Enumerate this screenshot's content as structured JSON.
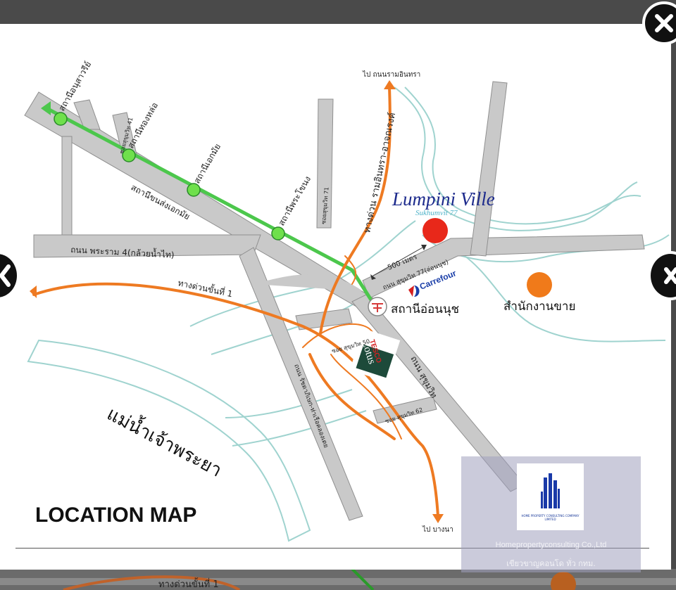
{
  "map": {
    "title": "LOCATION MAP",
    "project_name": "Lumpini Ville",
    "project_subname": "Sukhumvit 77",
    "river": "แม่น้ำเจ้าพระยา",
    "distance": "500 เมตร",
    "sales_office": "สำนักงานขาย",
    "bts_onnut": "สถานีอ่อนนุช",
    "carrefour": "Carrefour",
    "tesco_1": "TESCO",
    "tesco_2": "Lotus",
    "to_ramintra": "ไป ถนนรามอินทรา",
    "to_bangna": "ไป บางนา",
    "expressway_ramintra": "ทางด่วน รามอินทรา-อาจณรงค์",
    "expressway_1": "ทางด่วนขั้นที่ 1",
    "stations": {
      "victory": "สถานีอนุสาวรีย์",
      "thonglor": "สถานีทองหล่อ",
      "ekkamai": "สถานีเอกมัย",
      "phrakhanong": "สถานีพระโขนง",
      "bus_terminal": "สถานีขนส่งเอกมัย"
    },
    "roads": {
      "rama4": "ถนน พระราม 4(กล้วยน้ำไท)",
      "soi41": "ซอยสุขุมวิท 41",
      "soi71": "ซอยสุขุมวิท 71",
      "soi77": "ถนน สุขุมวิท 77(อ่อนนุช)",
      "soi50": "ซอย สุขุมวิท 50",
      "soi62": "ซอย สุขุมวิท 62",
      "sukhumvit": "ถนน สุขุมวิท",
      "kasemrat": "ถนน รัชดาภิเษก-ท่าเรือคลองเตย"
    },
    "colors": {
      "road": "#c9c9c9",
      "bts": "#4cc74c",
      "expressway": "#ee7a22",
      "river": "#9fd3cf",
      "project_marker": "#e8281a",
      "office_marker": "#f07a1a"
    }
  },
  "watermark": {
    "logo_caption": "HOME PROPERTY CONSULTING COMPANY LIMITED",
    "company": "Homepropertyconsulting Co.,Ltd",
    "tagline": "เขียวขาญคอนโด ทั่ว กทม."
  },
  "controls": {
    "close_icon": "close-icon",
    "prev_icon": "chevron-left-icon",
    "next_icon": "chevron-right-icon"
  }
}
